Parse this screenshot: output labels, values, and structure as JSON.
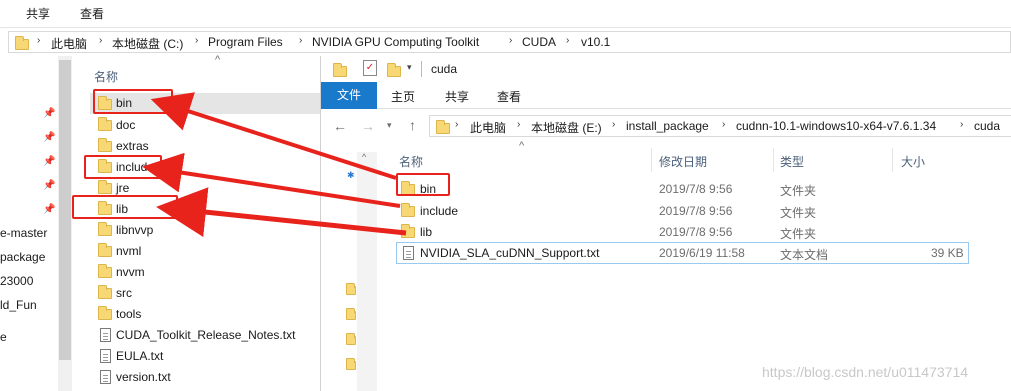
{
  "top_ribbon": {
    "tabs": [
      "共享",
      "查看"
    ]
  },
  "left_window": {
    "breadcrumb": [
      "此电脑",
      "本地磁盘 (C:)",
      "Program Files",
      "NVIDIA GPU Computing Toolkit",
      "CUDA",
      "v10.1"
    ],
    "column_name": "名称",
    "items": [
      {
        "name": "bin",
        "type": "folder"
      },
      {
        "name": "doc",
        "type": "folder"
      },
      {
        "name": "extras",
        "type": "folder"
      },
      {
        "name": "include",
        "type": "folder"
      },
      {
        "name": "jre",
        "type": "folder"
      },
      {
        "name": "lib",
        "type": "folder"
      },
      {
        "name": "libnvvp",
        "type": "folder"
      },
      {
        "name": "nvml",
        "type": "folder"
      },
      {
        "name": "nvvm",
        "type": "folder"
      },
      {
        "name": "src",
        "type": "folder"
      },
      {
        "name": "tools",
        "type": "folder"
      },
      {
        "name": "CUDA_Toolkit_Release_Notes.txt",
        "type": "file"
      },
      {
        "name": "EULA.txt",
        "type": "file"
      },
      {
        "name": "version.txt",
        "type": "file"
      }
    ],
    "nav_pane": [
      "e-master",
      "package",
      "23000",
      "ld_Fun",
      "e"
    ]
  },
  "right_window": {
    "title": "cuda",
    "ribbon_tabs": [
      "文件",
      "主页",
      "共享",
      "查看"
    ],
    "breadcrumb": [
      "此电脑",
      "本地磁盘 (E:)",
      "install_package",
      "cudnn-10.1-windows10-x64-v7.6.1.34",
      "cuda"
    ],
    "columns": {
      "name": "名称",
      "date": "修改日期",
      "type": "类型",
      "size": "大小"
    },
    "items": [
      {
        "name": "bin",
        "date": "2019/7/8 9:56",
        "type": "文件夹",
        "size": "",
        "kind": "folder"
      },
      {
        "name": "include",
        "date": "2019/7/8 9:56",
        "type": "文件夹",
        "size": "",
        "kind": "folder"
      },
      {
        "name": "lib",
        "date": "2019/7/8 9:56",
        "type": "文件夹",
        "size": "",
        "kind": "folder"
      },
      {
        "name": "NVIDIA_SLA_cuDNN_Support.txt",
        "date": "2019/6/19 11:58",
        "type": "文本文档",
        "size": "39 KB",
        "kind": "file"
      }
    ]
  },
  "watermark": "https://blog.csdn.net/u011473714",
  "colors": {
    "annotation": "#e8231c",
    "ribbon_active": "#1979ca",
    "folder": "#f8d775"
  }
}
